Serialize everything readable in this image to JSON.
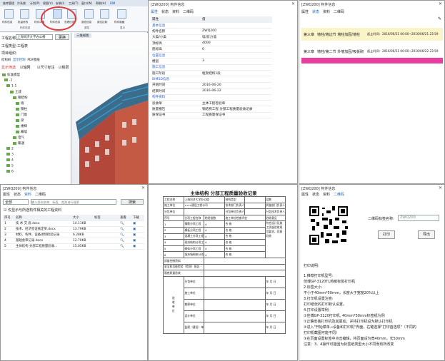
{
  "app": {
    "ribbon_tabs": [
      "族库管理",
      "冷系统",
      "计划(P)",
      "视图(V)",
      "安装(I)",
      "工具(T)",
      "窗口(W)",
      "帮助(H)",
      "BIM"
    ],
    "ribbon_buttons": [
      "构件信息",
      "批量修改",
      "构件详情",
      "构件信息",
      "查看信息",
      "属性信息",
      "属性控制",
      "构件隐藏"
    ],
    "groups": [
      "构件信息",
      "属性",
      "显示"
    ],
    "project_label": "工程名称:",
    "project_value": "上海同济大学办公楼",
    "switch_btn": "更换",
    "type_label": "工程类型:",
    "type_value": "工程表",
    "tree_label": "项目组织:",
    "subtabs": [
      "结构树",
      "显示控制",
      "PDF图纸"
    ],
    "filter_btn": "显示筛选",
    "chk": [
      "轴网",
      "尺寸标注",
      "楼层"
    ],
    "tree": [
      "标准模型",
      "-1",
      "1-1",
      "土建",
      "钢结构",
      "墙",
      "钢柱",
      "门窗",
      "梁",
      "楼梯",
      "幕墙",
      "电气",
      "暖通",
      "2",
      "3",
      "4",
      "5",
      "6"
    ],
    "view_tab": "三维视图"
  },
  "prop": {
    "title": "[ZWQ200] 构件信息",
    "tabs": [
      "属性",
      "状态",
      "资料",
      "二维码"
    ],
    "head": [
      "属性",
      "值"
    ],
    "rows": [
      [
        "基本信息",
        ""
      ],
      [
        "构件名称",
        "ZWQ200"
      ],
      [
        "大类/小类",
        "墙/剪力墙"
      ],
      [
        "顶标高",
        "4000"
      ],
      [
        "底标高",
        "0"
      ],
      [
        "位置信息",
        ""
      ],
      [
        "楼层",
        "3"
      ],
      [
        "施工信息",
        ""
      ],
      [
        "施工阶段",
        "框架结构1段"
      ],
      [
        "BIM5D信息",
        ""
      ],
      [
        "开始时间",
        "2016-06-20"
      ],
      [
        "结束时间",
        "2016-06-22"
      ],
      [
        "构件资料",
        ""
      ],
      [
        "验收单",
        "主体工程检验单"
      ],
      [
        "质量报告",
        "钢结构工程 分部工程质量验收记录"
      ],
      [
        "质保证书",
        "工程质量保证书"
      ]
    ]
  },
  "status": {
    "title": "[ZWQ200] 构件信息",
    "tabs": [
      "属性",
      "状态",
      "资料",
      "二维码"
    ],
    "rows": [
      {
        "stage": "第三章",
        "text": "墙柱/墙边节 墙柱加固/墙柱",
        "time": "起止时间：2016/06/21 00:00~2016/06/21 23:59"
      },
      {
        "stage": "第三章",
        "text": "墙柱/第二节 外墙加固/吸板砌",
        "time": "起止时间：2016/06/21 00:00~2016/06/22 23:59"
      }
    ],
    "colors": {
      "yellow": "#fbf4c9",
      "pink": "#e83ea0"
    }
  },
  "docs": {
    "title": "[ZWQ200] 构件信息",
    "tabs": [
      "属性",
      "状态",
      "资料",
      "二维码"
    ],
    "scope": "全部",
    "search_ph": "输入资料名称、标签、类别进行搜索",
    "search_btn": "搜索",
    "only_label": "仅显示与所选构件相关的工程资料",
    "head": [
      "序号",
      "名称",
      "大小",
      "标签",
      "查看",
      "下载"
    ],
    "rows": [
      [
        "1",
        "技 术 交 底.docx",
        "14.11KB"
      ],
      [
        "2",
        "技术、经济签证核定单.docx",
        "13.79KB"
      ],
      [
        "3",
        "材料、构件、设备进场检验记录",
        "6.28KB"
      ],
      [
        "4",
        "基础会审记录.docx",
        "12.70KB"
      ],
      [
        "5",
        "主体结构 分部工程质量验收...",
        "15.05KB"
      ]
    ]
  },
  "form": {
    "title": "主体结构 分部工程质量验收记录",
    "r1": [
      "工程名称",
      "上海同济大学办公楼",
      "结构类型",
      "",
      "层数",
      ""
    ],
    "r2": [
      "施工单位",
      "×××建设工程公司",
      "技术部门负责人",
      "",
      "质量部门负责人",
      ""
    ],
    "r3": [
      "分包单位",
      "",
      "分包单位负责人",
      "",
      "分包技术负责人",
      ""
    ],
    "head": [
      "序号",
      "分项工程名称",
      "检验批数",
      "施工单位检查评定",
      "验收意见"
    ],
    "items": [
      [
        "1",
        "钢筋分项工程",
        "4",
        "合 格"
      ],
      [
        "2",
        "模板分项工程",
        "4",
        "合 格"
      ],
      [
        "3",
        "混凝土分项工程",
        "4",
        "合 格"
      ],
      [
        "4",
        "现浇结构分项工程",
        "4",
        "合 格"
      ],
      [
        "5",
        "砌体分项工程",
        "4",
        "合 格"
      ],
      [
        "6",
        "填充墙砌体分项",
        "4",
        "合 格"
      ]
    ],
    "side_note": "符合设计及施工质量验收规范要求，同意验收",
    "qa": "质量控制资料",
    "safety": "安全和功能检验（检测）报告",
    "appear": "观感质量验收",
    "sign": [
      "分包单位",
      "施工单位",
      "勘察单位",
      "设计单位",
      "监理（建设）单位"
    ],
    "date": "年 月 日"
  },
  "qr": {
    "title": "[ZWQ200] 构件信息",
    "tabs": [
      "属性",
      "状态",
      "资料",
      "二维码"
    ],
    "name_label": "二维码标签名称:",
    "name_value": "ZWQ200",
    "print_btn": "打印",
    "export_btn": "导出",
    "notes": [
      "打印说明:",
      "1.推荐打印机型号:",
      "  佳博GP-3120TL热敏标签打印机",
      "2.标签大小:",
      "  不小于40mm*50mm，长度大于宽度20%以上",
      "3.打印机设置注意:",
      "  打印纸张的打印默认设置。",
      "4.打印设置举例:",
      "  ①佳博GP-3120打印机, 40mm*50mm标签纸为例",
      "  ①正确安装打印机及其驱动，并将打印机设为默认打印机",
      "  ②进入\"开始菜单→设备和打印机\"界面，右键选择\"打印首选项\"（不同的",
      "  打印机截图可能不同）",
      "  ③在页面设置标签中点击编辑，将页面设为宽40mm，长50mm",
      "  注意：3、4操作可能因为标签纸类型大小不同而有所改变"
    ]
  }
}
